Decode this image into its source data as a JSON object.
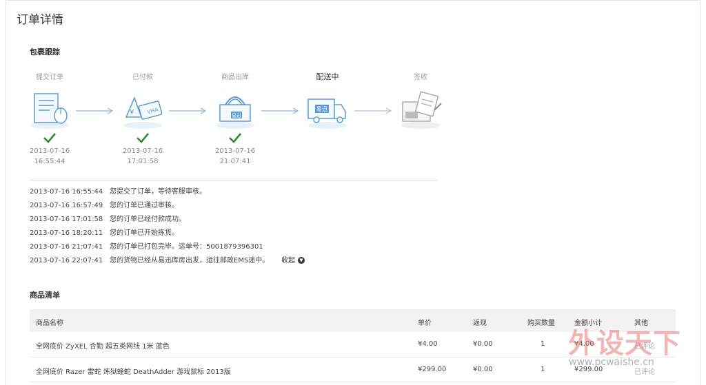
{
  "page_title": "订单详情",
  "tracking": {
    "title": "包裹跟踪",
    "steps": [
      {
        "label": "提交订单",
        "date": "2013-07-16",
        "time": "16:55:44",
        "done": true,
        "icon": "order-form-icon"
      },
      {
        "label": "已付款",
        "date": "2013-07-16",
        "time": "17:01:58",
        "done": true,
        "icon": "payment-card-icon"
      },
      {
        "label": "商品出库",
        "date": "2013-07-16",
        "time": "21:07:41",
        "done": true,
        "icon": "package-box-icon"
      },
      {
        "label": "配送中",
        "date": "",
        "time": "",
        "done": false,
        "current": true,
        "icon": "delivery-truck-icon"
      },
      {
        "label": "签收",
        "date": "",
        "time": "",
        "done": false,
        "icon": "signed-receipt-icon"
      }
    ],
    "logs": [
      {
        "time": "2013-07-16 16:55:44",
        "text": "您提交了订单，等待客服审核。"
      },
      {
        "time": "2013-07-16 16:57:49",
        "text": "您的订单已通过审核。"
      },
      {
        "time": "2013-07-16 17:01:58",
        "text": "您的订单已经付款成功。"
      },
      {
        "time": "2013-07-16 18:20:11",
        "text": "您的订单已开始拣货。"
      },
      {
        "time": "2013-07-16 21:07:41",
        "text": "您的订单已打包完毕。运单号：5001879396301"
      },
      {
        "time": "2013-07-16 22:07:41",
        "text": "您的货物已经从易迅库房出发，运往邮政EMS途中。"
      }
    ],
    "collapse_label": "收起",
    "truck_brand": "易迅"
  },
  "products": {
    "title": "商品清单",
    "headers": [
      "商品名称",
      "单价",
      "返现",
      "购买数量",
      "金额小计",
      "其他"
    ],
    "rows": [
      {
        "name": "全网底价 ZyXEL 合勤 超五类网线 1米 蓝色",
        "price": "¥4.00",
        "cashback": "¥0.00",
        "qty": "1",
        "subtotal": "¥4.00",
        "other": "已评论"
      },
      {
        "name": "全网底价 Razer 雷蛇 炼狱蝰蛇 DeathAdder 游戏鼠标 2013版",
        "price": "¥299.00",
        "cashback": "¥0.00",
        "qty": "1",
        "subtotal": "¥299.00",
        "other": "已评论"
      }
    ]
  },
  "watermark": {
    "main": "外设天下",
    "url": "www.pcwaishe.cn"
  },
  "colors": {
    "check": "#2e8b2e",
    "arrow": "#8fb8dc",
    "icon_blue": "#5b9bd5",
    "header_bg": "#f2f2f2"
  }
}
